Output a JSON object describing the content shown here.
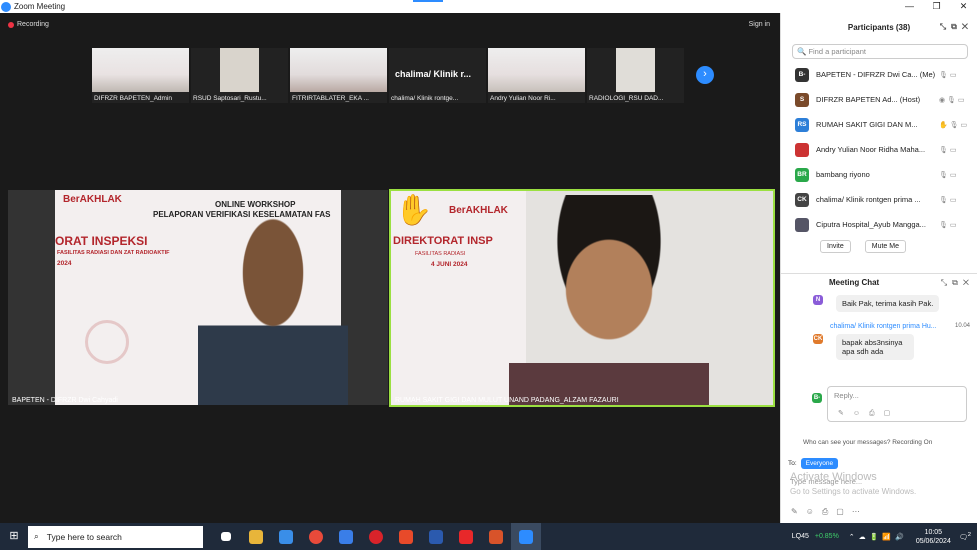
{
  "window": {
    "title": "Zoom Meeting",
    "controls": [
      "—",
      "❐",
      "✕"
    ]
  },
  "stage": {
    "recording": "Recording",
    "signin": "Sign in"
  },
  "thumbnails": [
    {
      "name": "DIFRZR BAPETEN_Admin"
    },
    {
      "name": "RSUD Saptosari_Rustu..."
    },
    {
      "name": "FITRIRTABLATER_EKA ..."
    },
    {
      "name": "chalima/ Klinik rontge...",
      "display": "chalima/ Klinik r..."
    },
    {
      "name": "Andry Yulian Noor Ri..."
    },
    {
      "name": "RADIOLOGI_RSU DAD..."
    }
  ],
  "tiles": [
    {
      "caption": "BAPETEN - DIFRZR Dwi Cahyadi",
      "slide_brand": "BerAKHLAK",
      "slide_title1": "ONLINE WORKSHOP",
      "slide_title2": "PELAPORAN VERIFIKASI KESELAMATAN FAS",
      "slide_big": "ORAT INSPEKSI",
      "slide_sub": "FASILITAS RADIASI DAN ZAT RADIOAKTIF",
      "slide_year": "2024"
    },
    {
      "caption": "RUMAH SAKIT GIGI DAN MULUT UNAND PADANG_ALZAM FAZAURI",
      "slide_brand": "BerAKHLAK",
      "slide_big": "DIREKTORAT INSP",
      "slide_sub": "FASILITAS RADIASI",
      "slide_date": "4 JUNI 2024",
      "hand": "✋"
    }
  ],
  "participants": {
    "title": "Participants (38)",
    "search_placeholder": "Find a participant",
    "list": [
      {
        "initials": "B-",
        "color": "#333",
        "name": "BAPETEN - DIFRZR Dwi Ca... (Me)",
        "icons": "🎙 ▭"
      },
      {
        "initials": "S",
        "color": "#7a4a2a",
        "name": "DIFRZR BAPETEN Ad... (Host)",
        "icons": "◉ 🎙 ▭"
      },
      {
        "initials": "RS",
        "color": "#2d7fd8",
        "name": "RUMAH SAKIT GIGI DAN M...",
        "icons": "✋ 🎙 ▭"
      },
      {
        "initials": "",
        "color": "#c33",
        "name": "Andry Yulian Noor Ridha Maha...",
        "icons": "🎙 ▭"
      },
      {
        "initials": "BR",
        "color": "#2aa84a",
        "name": "bambang riyono",
        "icons": "🎙 ▭"
      },
      {
        "initials": "CK",
        "color": "#444",
        "name": "chalima/ Klinik rontgen prima ...",
        "icons": "🎙 ▭"
      },
      {
        "initials": "",
        "color": "#556",
        "name": "Ciputra Hospital_Ayub Mangga...",
        "icons": "🎙 ▭"
      }
    ],
    "invite": "Invite",
    "mute": "Mute Me"
  },
  "chat": {
    "title": "Meeting Chat",
    "msg1": "Baik Pak, terima kasih Pak.",
    "sender2": "chalima/ Klinik rontgen prima Hu...",
    "time2": "10.04",
    "msg2": "bapak abs3nsinya apa sdh ada",
    "reply_placeholder": "Reply...",
    "whocan": "Who can see your messages? Recording On",
    "to_label": "To:",
    "to_value": "Everyone",
    "type_placeholder": "Type message here...",
    "activate1": "Activate Windows",
    "activate2": "Go to Settings to activate Windows."
  },
  "taskbar": {
    "search": "Type here to search",
    "stock": "LQ45",
    "stock_change": "+0.85%",
    "time": "10:05",
    "date": "05/06/2024",
    "notif": "2"
  }
}
